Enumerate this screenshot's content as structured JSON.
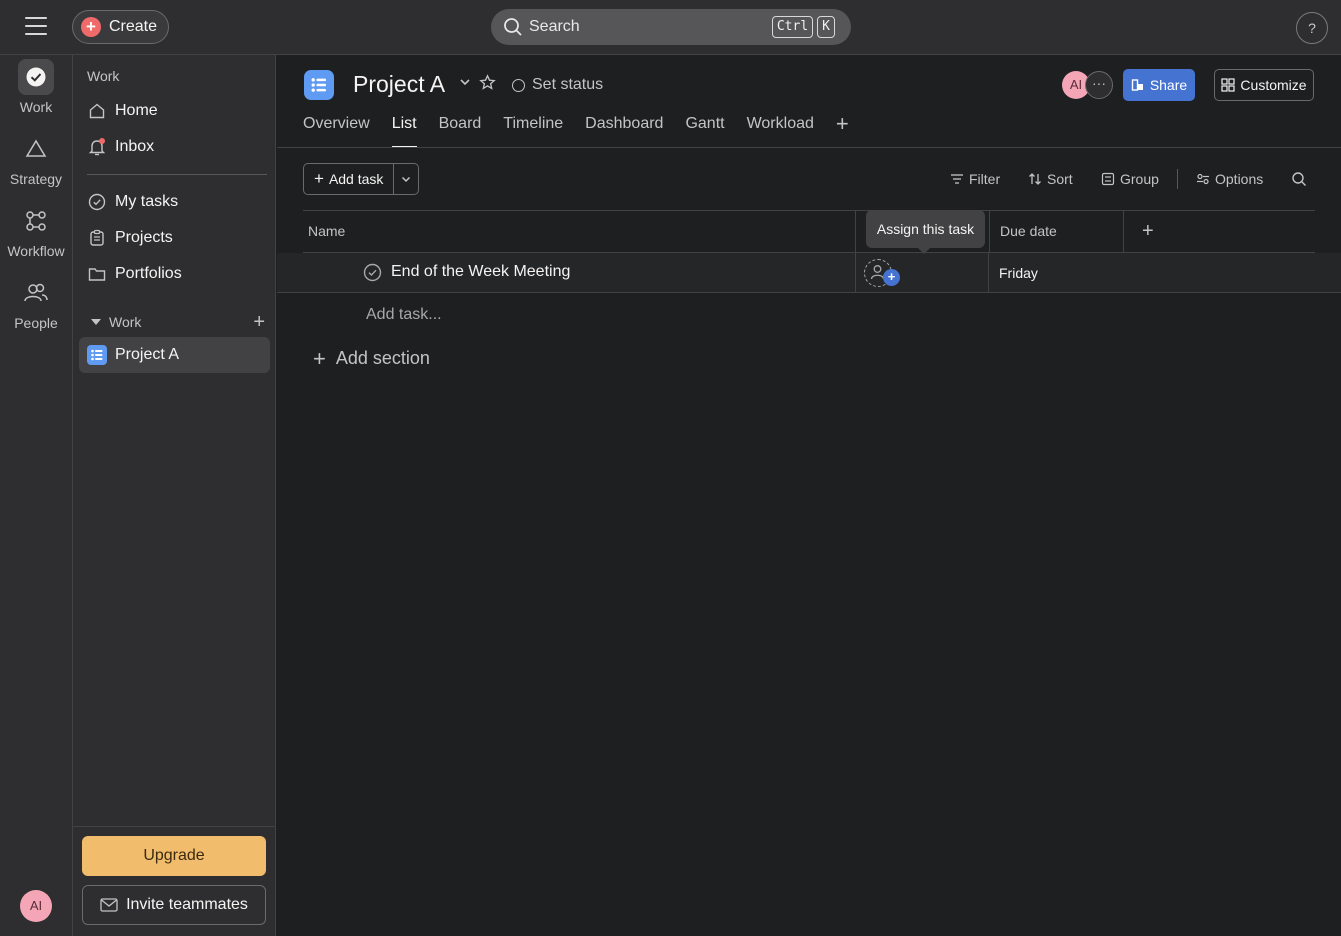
{
  "topbar": {
    "create_label": "Create",
    "search_label": "Search",
    "kbd_ctrl": "Ctrl",
    "kbd_k": "K",
    "help_label": "?"
  },
  "rail": {
    "items": [
      {
        "label": "Work",
        "icon": "check-circle-icon"
      },
      {
        "label": "Strategy",
        "icon": "triangle-icon"
      },
      {
        "label": "Workflow",
        "icon": "workflow-icon"
      },
      {
        "label": "People",
        "icon": "people-icon"
      }
    ],
    "avatar": "AI"
  },
  "sidebar": {
    "heading": "Work",
    "items": [
      {
        "label": "Home",
        "icon": "home-icon"
      },
      {
        "label": "Inbox",
        "icon": "bell-icon"
      },
      {
        "label": "My tasks",
        "icon": "check-circle-icon"
      },
      {
        "label": "Projects",
        "icon": "clipboard-icon"
      },
      {
        "label": "Portfolios",
        "icon": "folder-icon"
      }
    ],
    "section_label": "Work",
    "project_label": "Project A",
    "upgrade_label": "Upgrade",
    "invite_label": "Invite teammates"
  },
  "project": {
    "title": "Project A",
    "set_status": "Set status",
    "avatar": "AI",
    "more": "···",
    "share_label": "Share",
    "customize_label": "Customize",
    "tabs": [
      "Overview",
      "List",
      "Board",
      "Timeline",
      "Dashboard",
      "Gantt",
      "Workload"
    ],
    "active_tab": "List"
  },
  "toolbar": {
    "add_task": "Add task",
    "filter": "Filter",
    "sort": "Sort",
    "group": "Group",
    "options": "Options"
  },
  "table": {
    "headers": {
      "name": "Name",
      "due": "Due date",
      "add": "+"
    },
    "rows": [
      {
        "name": "End of the Week Meeting",
        "assignee": "",
        "due": "Friday"
      }
    ],
    "add_task_placeholder": "Add task...",
    "add_section": "Add section"
  },
  "tooltip": "Assign this task",
  "colors": {
    "background": "#1e1f21",
    "panel": "#2e2e30",
    "accent_blue": "#4573d2",
    "project_icon": "#5f9bf2",
    "create_red": "#f06a6a",
    "upgrade": "#f1bd6c",
    "avatar": "#f4a6b6"
  }
}
